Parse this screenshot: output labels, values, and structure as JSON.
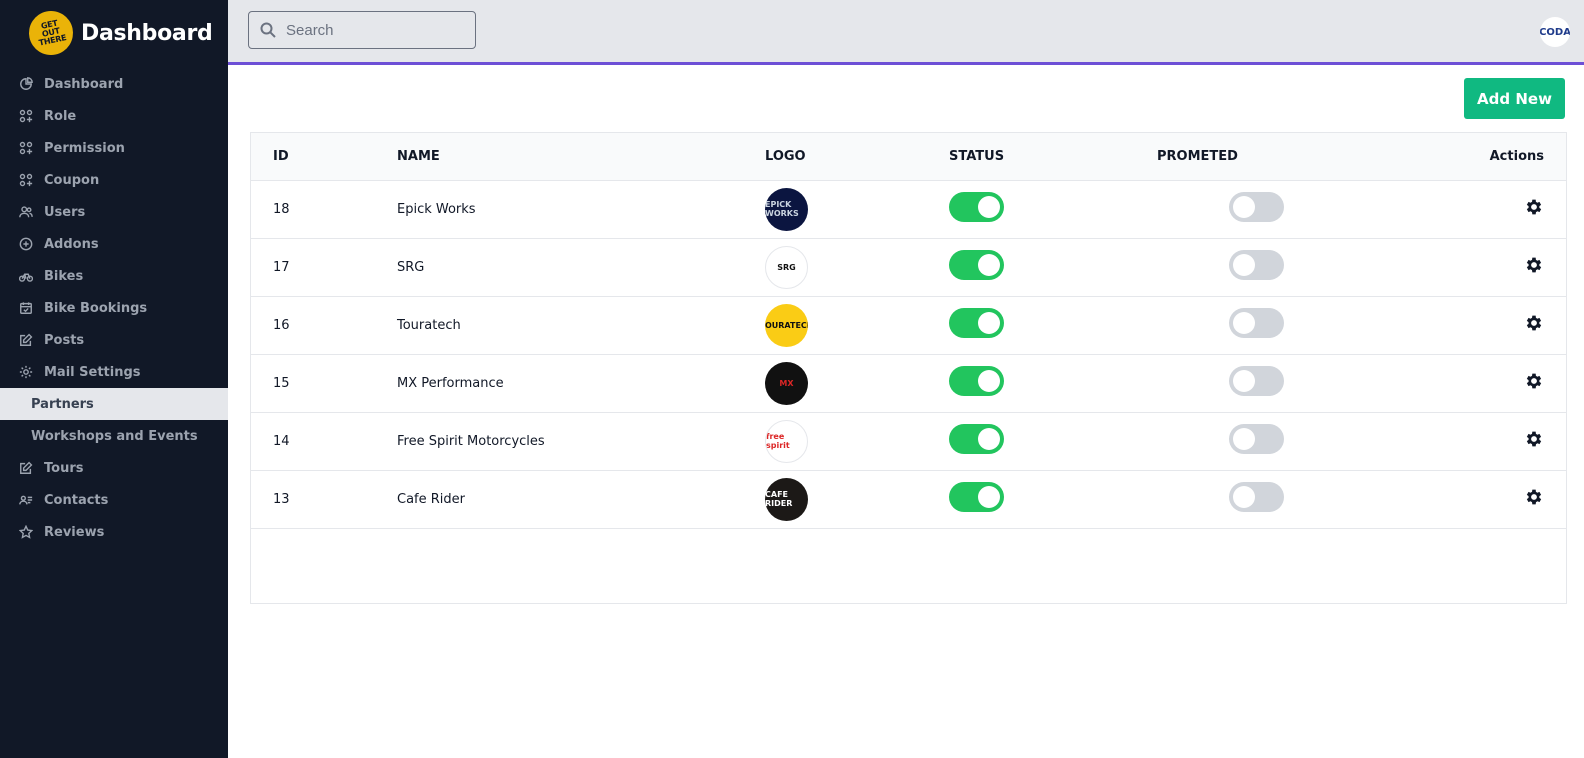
{
  "brand": {
    "title": "Dashboard",
    "logo_lines": [
      "GET",
      "OUT",
      "THERE"
    ]
  },
  "sidebar": {
    "items": [
      {
        "label": "Dashboard",
        "icon": "pie-chart-icon"
      },
      {
        "label": "Role",
        "icon": "grid-plus-icon"
      },
      {
        "label": "Permission",
        "icon": "grid-plus-icon"
      },
      {
        "label": "Coupon",
        "icon": "grid-plus-icon"
      },
      {
        "label": "Users",
        "icon": "users-icon"
      },
      {
        "label": "Addons",
        "icon": "plus-circle-icon"
      },
      {
        "label": "Bikes",
        "icon": "bike-icon"
      },
      {
        "label": "Bike Bookings",
        "icon": "calendar-check-icon"
      },
      {
        "label": "Posts",
        "icon": "edit-icon"
      },
      {
        "label": "Mail Settings",
        "icon": "gear-icon"
      }
    ],
    "subitems": [
      {
        "label": "Partners",
        "active": true
      },
      {
        "label": "Workshops and Events",
        "active": false
      }
    ],
    "items2": [
      {
        "label": "Tours",
        "icon": "edit-icon"
      },
      {
        "label": "Contacts",
        "icon": "contact-card-icon"
      },
      {
        "label": "Reviews",
        "icon": "star-icon"
      }
    ]
  },
  "topbar": {
    "search_placeholder": "Search",
    "avatar_text": "CODA"
  },
  "main": {
    "add_button": "Add New",
    "columns": [
      "ID",
      "NAME",
      "LOGO",
      "STATUS",
      "PROMETED",
      "Actions"
    ],
    "rows": [
      {
        "id": "18",
        "name": "Epick Works",
        "logo_text": "EPICK WORKS",
        "logo_bg": "#0b1540",
        "logo_fg": "#cbd5e1",
        "status": true,
        "prometed": false
      },
      {
        "id": "17",
        "name": "SRG",
        "logo_text": "SRG",
        "logo_bg": "#ffffff",
        "logo_fg": "#111111",
        "status": true,
        "prometed": false
      },
      {
        "id": "16",
        "name": "Touratech",
        "logo_text": "TOURATECH",
        "logo_bg": "#facc15",
        "logo_fg": "#111111",
        "status": true,
        "prometed": false
      },
      {
        "id": "15",
        "name": "MX Performance",
        "logo_text": "MX",
        "logo_bg": "#111111",
        "logo_fg": "#dc2626",
        "status": true,
        "prometed": false
      },
      {
        "id": "14",
        "name": "Free Spirit Motorcycles",
        "logo_text": "free spirit",
        "logo_bg": "#ffffff",
        "logo_fg": "#dc2626",
        "status": true,
        "prometed": false
      },
      {
        "id": "13",
        "name": "Cafe Rider",
        "logo_text": "CAFE RIDER",
        "logo_bg": "#1c1917",
        "logo_fg": "#ffffff",
        "status": true,
        "prometed": false
      }
    ]
  },
  "colors": {
    "sidebar_bg": "#111827",
    "accent": "#6d4fd6",
    "add_button": "#10b981",
    "toggle_on": "#22c55e",
    "toggle_off": "#d1d5db"
  }
}
